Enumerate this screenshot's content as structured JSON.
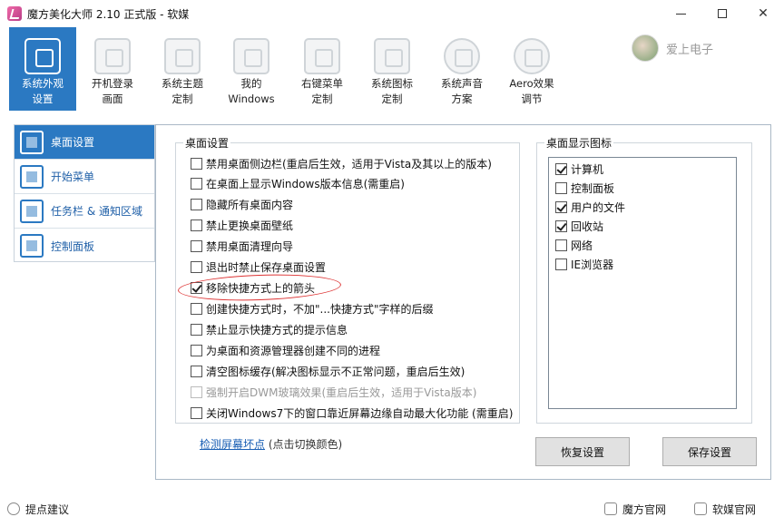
{
  "window": {
    "title": "魔方美化大师 2.10 正式版 - 软媒"
  },
  "toolbar": {
    "items": [
      {
        "line1": "系统外观",
        "line2": "设置",
        "icon": "appearance-icon",
        "active": true
      },
      {
        "line1": "开机登录",
        "line2": "画面",
        "icon": "login-screen-icon"
      },
      {
        "line1": "系统主题",
        "line2": "定制",
        "icon": "theme-icon"
      },
      {
        "line1": "我的",
        "line2": "Windows",
        "icon": "windows-icon"
      },
      {
        "line1": "右键菜单",
        "line2": "定制",
        "icon": "context-menu-icon"
      },
      {
        "line1": "系统图标",
        "line2": "定制",
        "icon": "system-icons-icon"
      },
      {
        "line1": "系统声音",
        "line2": "方案",
        "icon": "sound-icon"
      },
      {
        "line1": "Aero效果",
        "line2": "调节",
        "icon": "aero-icon"
      }
    ]
  },
  "user": {
    "name": "爱上电子"
  },
  "sidebar": {
    "items": [
      {
        "label": "桌面设置",
        "icon": "desktop-settings-icon",
        "active": true
      },
      {
        "label": "开始菜单",
        "icon": "start-menu-icon"
      },
      {
        "label": "任务栏 & 通知区域",
        "icon": "taskbar-icon"
      },
      {
        "label": "控制面板",
        "icon": "control-panel-icon"
      }
    ]
  },
  "desktop_settings": {
    "title": "桌面设置",
    "options": [
      {
        "label": "禁用桌面侧边栏(重启后生效，适用于Vista及其以上的版本)",
        "checked": false
      },
      {
        "label": "在桌面上显示Windows版本信息(需重启)",
        "checked": false
      },
      {
        "label": "隐藏所有桌面内容",
        "checked": false
      },
      {
        "label": "禁止更换桌面壁纸",
        "checked": false
      },
      {
        "label": "禁用桌面清理向导",
        "checked": false
      },
      {
        "label": "退出时禁止保存桌面设置",
        "checked": false
      },
      {
        "label": "移除快捷方式上的箭头",
        "checked": true
      },
      {
        "label": "创建快捷方式时，不加\"...快捷方式\"字样的后缀",
        "checked": false
      },
      {
        "label": "禁止显示快捷方式的提示信息",
        "checked": false
      },
      {
        "label": "为桌面和资源管理器创建不同的进程",
        "checked": false
      },
      {
        "label": "清空图标缓存(解决图标显示不正常问题，重启后生效)",
        "checked": false
      },
      {
        "label": "强制开启DWM玻璃效果(重启后生效，适用于Vista版本)",
        "checked": false,
        "disabled": true
      },
      {
        "label": "关闭Windows7下的窗口靠近屏幕边缘自动最大化功能 (需重启)",
        "checked": false
      }
    ]
  },
  "desktop_icons": {
    "title": "桌面显示图标",
    "options": [
      {
        "label": "计算机",
        "checked": true
      },
      {
        "label": "控制面板",
        "checked": false
      },
      {
        "label": "用户的文件",
        "checked": true
      },
      {
        "label": "回收站",
        "checked": true
      },
      {
        "label": "网络",
        "checked": false
      },
      {
        "label": "IE浏览器",
        "checked": false
      }
    ]
  },
  "screen_check": {
    "link": "检测屏幕坏点",
    "hint": "(点击切换颜色)"
  },
  "buttons": {
    "restore": "恢复设置",
    "save": "保存设置"
  },
  "footer": {
    "feedback": "提点建议",
    "mofang_site": "魔方官网",
    "ruanmei_site": "软媒官网"
  },
  "colors": {
    "accent": "#2b79c2",
    "annotation_red": "#dd3333"
  }
}
